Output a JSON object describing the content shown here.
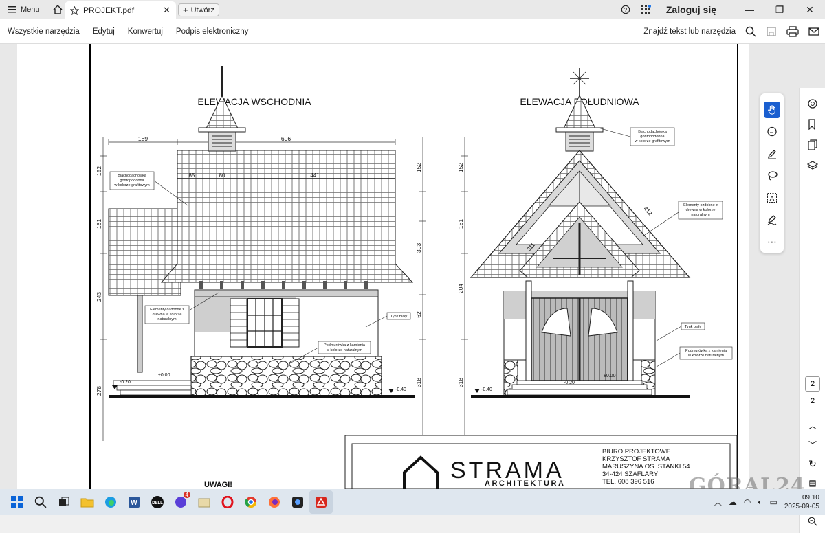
{
  "titlebar": {
    "menu_label": "Menu",
    "tab_title": "PROJEKT.pdf",
    "new_tab_label": "Utwórz",
    "login_label": "Zaloguj się"
  },
  "menubar": {
    "items": [
      "Wszystkie narzędzia",
      "Edytuj",
      "Konwertuj",
      "Podpis elektroniczny"
    ],
    "search_label": "Znajdź tekst lub narzędzia"
  },
  "drawing": {
    "east_title": "ELEWACJA WSCHODNIA",
    "south_title": "ELEWACJA POŁUDNIOWA",
    "east_dims": {
      "left_top": "152",
      "left_mid": "161",
      "left_low": "243",
      "left_bottom": "278",
      "top_left": "189",
      "top_right": "606",
      "inner_a": "85",
      "inner_b": "80",
      "inner_c": "441",
      "right_top": "152",
      "right_mid": "303",
      "right_low": "62",
      "right_bottom": "318",
      "lvl_a": "-0.20",
      "lvl_b": "±0.00",
      "lvl_c": "-0.40"
    },
    "south_dims": {
      "left_top": "152",
      "left_mid": "161",
      "left_low": "204",
      "left_bottom": "318",
      "roof_a": "412",
      "roof_b": "311",
      "lvl_a": "-0.40",
      "lvl_b": "-0.20",
      "lvl_c": "±0.00"
    },
    "east_notes": {
      "roof": [
        "Blachodachówka",
        "gontopodobna",
        "w kolorze grafitowym"
      ],
      "wood": [
        "Elementy ozdobne z",
        "drewna w kolorze",
        "naturalnym"
      ],
      "plaster": "Tynk biały",
      "stone": [
        "Podmurówka z kamienia",
        "w kolorze naturalnym"
      ]
    },
    "south_notes": {
      "roof": [
        "Blachodachówka",
        "gontopodobna",
        "w kolorze grafitowym"
      ],
      "wood": [
        "Elementy ozdobne z",
        "drewna w kolorze",
        "naturalnym"
      ],
      "plaster": "Tynk biały",
      "stone": [
        "Podmurówka z kamienia",
        "w kolorze naturalnym"
      ]
    },
    "title_block": {
      "logo_main": "STRAMA",
      "logo_sub": "ARCHITEKTURA",
      "office": [
        "BIURO PROJEKTOWE",
        "KRZYSZTOF STRAMA",
        "MARUSZYNA OS. STANKI 54",
        "34-424 SZAFLARY",
        "TEL. 608 396 516"
      ],
      "remarks": "UWAGI!"
    }
  },
  "pager": {
    "current_page": "2",
    "total_pages": "2"
  },
  "taskbar": {
    "time": "09:10",
    "date": "2025-09-05",
    "badge": "4"
  },
  "watermark": "GÓRAL24",
  "icons": [
    "hamburger-icon",
    "home-icon",
    "star-icon",
    "close-icon",
    "plus-icon",
    "help-icon",
    "apps-icon",
    "minimize-icon",
    "maximize-icon",
    "search-icon",
    "save-icon",
    "print-icon",
    "email-icon",
    "hand-icon",
    "comment-icon",
    "pen-icon",
    "lasso-icon",
    "text-select-icon",
    "sign-icon",
    "more-icon"
  ]
}
